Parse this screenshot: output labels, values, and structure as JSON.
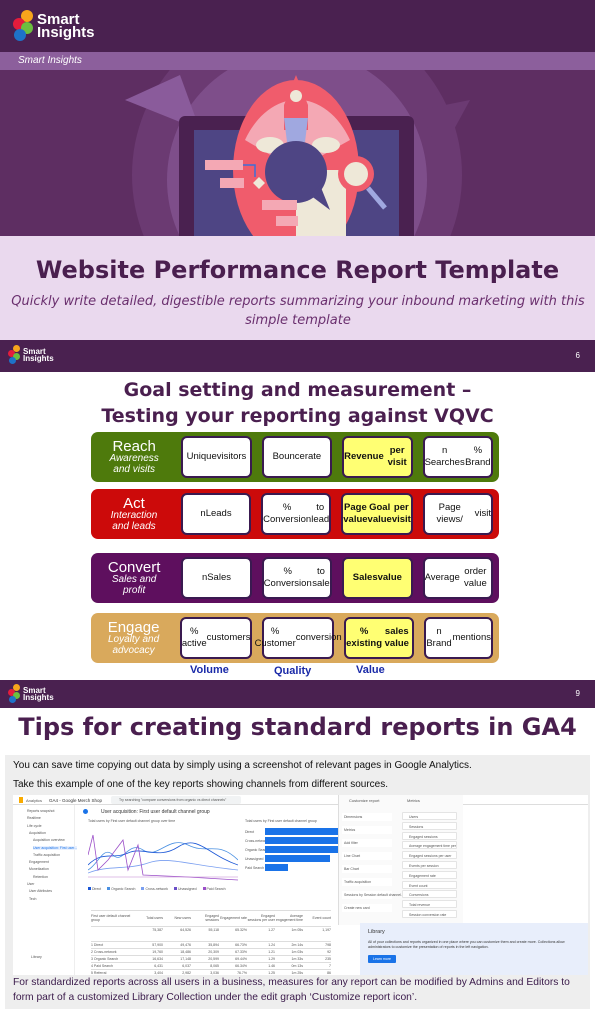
{
  "brand": {
    "logo_text_1": "Smart",
    "logo_text_2": "Insights",
    "band_label": "Smart Insights"
  },
  "cover": {
    "title": "Website Performance Report Template",
    "subtitle": "Quickly write detailed, digestible reports summarizing your inbound marketing with this simple template"
  },
  "slide6": {
    "page_number": "6",
    "title_line1": "Goal setting and measurement –",
    "title_line2": "Testing your reporting against VQVC",
    "rows": [
      {
        "label": "Reach",
        "sub1": "Awareness",
        "sub2": "and visits",
        "color": "#4e7a0c",
        "cells": [
          [
            "Unique",
            "visitors"
          ],
          [
            "Bounce",
            "rate"
          ],
          [
            "Revenue",
            "per visit"
          ],
          [
            "n Searches",
            "% Brand"
          ]
        ]
      },
      {
        "label": "Act",
        "sub1": "Interaction",
        "sub2": "and leads",
        "color": "#cc0a0a",
        "cells": [
          [
            "nLeads",
            ""
          ],
          [
            "% Conversion",
            "to lead"
          ],
          [
            "Page value",
            "Goal value",
            "per visit"
          ],
          [
            "Page views/",
            "visit"
          ]
        ]
      },
      {
        "label": "Convert",
        "sub1": "Sales and",
        "sub2": "profit",
        "color": "#5e0f5e",
        "cells": [
          [
            "nSales",
            ""
          ],
          [
            "% Conversion",
            "to sale"
          ],
          [
            "Sales",
            "value"
          ],
          [
            "Average",
            "order value"
          ]
        ]
      },
      {
        "label": "Engage",
        "sub1": "Loyalty and",
        "sub2": "advocacy",
        "color": "#d9a95c",
        "cells": [
          [
            "% active",
            "customers"
          ],
          [
            "% Customer",
            "conversion"
          ],
          [
            "% existing",
            "sales value"
          ],
          [
            "n Brand",
            "mentions"
          ]
        ]
      }
    ],
    "highlight_color": "#ffff73",
    "columns": [
      "Volume",
      "Quality",
      "Value"
    ]
  },
  "slide9": {
    "page_number": "9",
    "title": "Tips for creating standard reports in GA4",
    "intro1": "You can save time copying out data by simply using a screenshot of relevant pages in Google Analytics.",
    "intro2": "Take this example of one of the key reports showing channels from different sources.",
    "outro": "For standardized reports across all users in a business, measures for any report can be modified by Admins and Editors to form part of a customized Library Collection under the edit graph ‘Customize report icon’.",
    "ga": {
      "app": "Analytics",
      "property": "GA4 - Google Merch Shop",
      "search_placeholder": "Try searching \"compare conversions from organic vs direct channels\"",
      "nav": [
        "Reports snapshot",
        "Realtime",
        "Life cycle",
        "Acquisition",
        "Acquisition overview",
        "User acquisition: First user...",
        "Traffic acquisition",
        "Engagement",
        "Monetization",
        "Retention",
        "User",
        "User Attributes",
        "Tech",
        "Library"
      ],
      "report_title": "User acquisition: First user default channel group",
      "chart_caption": "Total users by First user default channel group over time",
      "bar_caption": "Total users by First user default channel group",
      "bar_labels": [
        "Direct",
        "Cross-network",
        "Organic Search",
        "Unassigned",
        "Paid Search"
      ],
      "bar_values": [
        100,
        95,
        88,
        72,
        25
      ],
      "legend": [
        "Direct",
        "Organic Search",
        "Cross-network",
        "Unassigned",
        "Paid Search"
      ],
      "table_headers": [
        "First user default channel group",
        "Total users",
        "New users",
        "Engaged sessions",
        "Engagement rate",
        "Engaged sessions per user",
        "Average engagement time",
        "Event count"
      ],
      "totals": [
        "",
        "75,387",
        "64,526",
        "55,118",
        "65.32%",
        "1.27",
        "1m 05s",
        "1,197"
      ],
      "rows": [
        [
          "1 Direct",
          "57,900",
          "49,476",
          "35,894",
          "66.73%",
          "1.24",
          "2m 14s",
          "798"
        ],
        [
          "2 Cross-network",
          "19,760",
          "18,486",
          "20,309",
          "67.33%",
          "1.21",
          "1m 03s",
          "92"
        ],
        [
          "3 Organic Search",
          "16,634",
          "17,148",
          "20,599",
          "69.44%",
          "1.29",
          "1m 33s",
          "235"
        ],
        [
          "4 Paid Search",
          "6,431",
          "6,037",
          "8,065",
          "66.34%",
          "1.46",
          "0m 13s",
          "7"
        ],
        [
          "5 Referral",
          "3,404",
          "2,982",
          "3,036",
          "76.7%",
          "1.25",
          "1m 25s",
          "86"
        ],
        [
          "6 Organic Social",
          "713",
          "610",
          "869",
          "63.48%",
          "1.25",
          "2m 06s",
          "18"
        ],
        [
          "7 Email",
          "393",
          "301",
          "671",
          "90.32%",
          "1.38",
          "8m 52s",
          "22"
        ]
      ],
      "customize_title": "Customize report",
      "customize_items": [
        "Dimensions",
        "Metrics",
        "Add filter",
        "Line Chart",
        "Bar Chart",
        "Traffic acquisition",
        "Sessions by Session default channel...",
        "Create new card"
      ],
      "metrics_title": "Metrics",
      "metrics": [
        "Users",
        "Sessions",
        "Engaged sessions",
        "Average engagement time per session",
        "Engaged sessions per user",
        "Events per session",
        "Engagement rate",
        "Event count",
        "Conversions",
        "Total revenue",
        "Session conversion rate"
      ],
      "library_title": "Library",
      "library_text": "All of your collections and reports organized in one place where you can customize them and create more. Collections allow administrators to customize the presentation of reports in the left navigation.",
      "learn_more": "Learn more"
    }
  },
  "colors": {
    "header": "#4a2150",
    "band": "#8c5f9c",
    "hero": "#5e2e62",
    "title": "#4a1f4f",
    "cover_bg": "#ead9ee"
  }
}
